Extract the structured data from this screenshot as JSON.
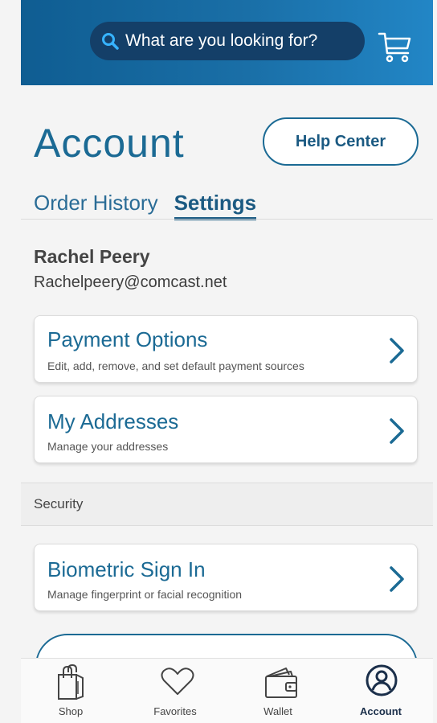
{
  "header": {
    "search_placeholder": "What are you looking for?",
    "search_icon": "search-icon",
    "cart_icon": "cart-icon"
  },
  "page": {
    "title": "Account",
    "help_button": "Help Center"
  },
  "tabs": [
    {
      "label": "Order History",
      "active": false
    },
    {
      "label": "Settings",
      "active": true
    }
  ],
  "user": {
    "name": "Rachel Peery",
    "email": "Rachelpeery@comcast.net"
  },
  "cards": {
    "payment": {
      "title": "Payment Options",
      "subtitle": "Edit, add, remove, and set default payment sources"
    },
    "addresses": {
      "title": "My Addresses",
      "subtitle": "Manage your addresses"
    },
    "biometric": {
      "title": "Biometric Sign In",
      "subtitle": "Manage fingerprint or facial recognition"
    }
  },
  "sections": {
    "security": "Security"
  },
  "bottom_nav": [
    {
      "label": "Shop",
      "icon": "shopping-bag-icon"
    },
    {
      "label": "Favorites",
      "icon": "heart-icon"
    },
    {
      "label": "Wallet",
      "icon": "wallet-icon"
    },
    {
      "label": "Account",
      "icon": "account-icon",
      "active": true
    }
  ],
  "colors": {
    "brand": "#1b6a94",
    "header_start": "#0f5d92",
    "header_end": "#2286c6",
    "search_bg": "#143f68"
  }
}
